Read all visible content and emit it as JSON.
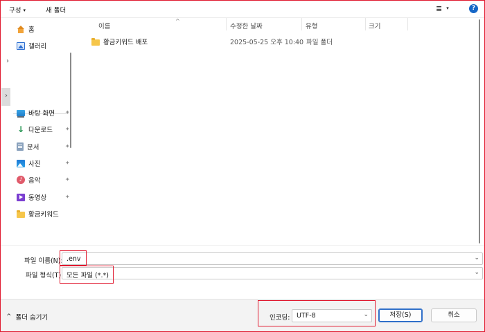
{
  "toolbar": {
    "organize_label": "구성",
    "organize_caret": "▾",
    "new_folder_label": "새 폴더",
    "view_icon": "≣",
    "view_caret": "▾",
    "help_label": "?"
  },
  "nav": {
    "quick_items": [
      {
        "label": "홈",
        "icon": "home-icon"
      },
      {
        "label": "갤러리",
        "icon": "gallery-icon"
      }
    ],
    "expand_glyph": "›",
    "pinned_items": [
      {
        "label": "바탕 화면",
        "icon": "desktop-icon",
        "pinned": true
      },
      {
        "label": "다운로드",
        "icon": "download-icon",
        "pinned": true
      },
      {
        "label": "문서",
        "icon": "documents-icon",
        "pinned": true
      },
      {
        "label": "사진",
        "icon": "photos-icon",
        "pinned": true
      },
      {
        "label": "음악",
        "icon": "music-icon",
        "pinned": true
      },
      {
        "label": "동영상",
        "icon": "videos-icon",
        "pinned": true
      },
      {
        "label": "황금키워드",
        "icon": "folder-icon",
        "pinned": false
      }
    ],
    "pin_glyph": "📌",
    "download_glyph": "↓",
    "music_glyph": "♪"
  },
  "columns": {
    "name": "이름",
    "modified": "수정한 날짜",
    "type": "유형",
    "size": "크기",
    "sort_glyph": "^"
  },
  "files": [
    {
      "name": "황금키워드 배포",
      "modified": "2025-05-25 오후 10:40",
      "type": "파일 폴더",
      "size": ""
    }
  ],
  "form": {
    "filename_label": "파일 이름(N):",
    "filename_value": ".env",
    "filetype_label": "파일 형식(T):",
    "filetype_value": "모든 파일  (*.*)",
    "encoding_label": "인코딩:",
    "encoding_value": "UTF-8",
    "chevron": "⌄"
  },
  "footer": {
    "hide_folders_label": "폴더 숨기기",
    "hide_folders_chevron": "^",
    "save_label": "저장(S)",
    "cancel_label": "취소"
  },
  "colors": {
    "highlight_border": "#e0182e",
    "primary_button_border": "#2f6fc9",
    "help_badge": "#1667c7"
  }
}
